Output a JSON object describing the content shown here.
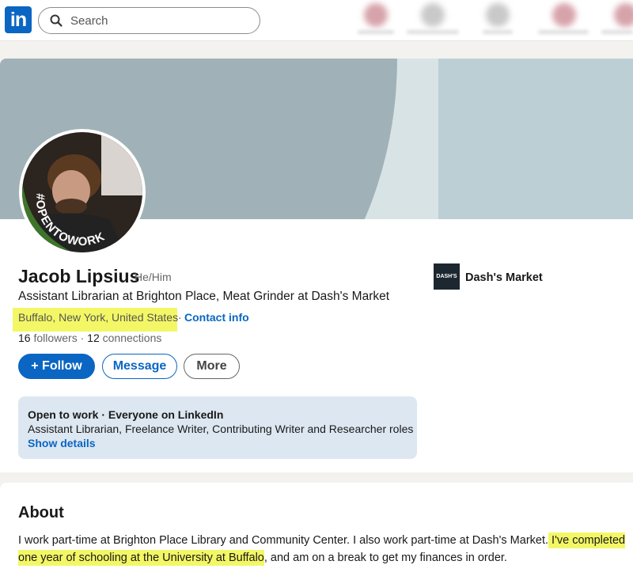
{
  "nav": {
    "logo_text": "in",
    "search_placeholder": "Search"
  },
  "profile": {
    "open_to_work_badge": "#OPENTOWORK",
    "name": "Jacob Lipsius",
    "pronouns": "He/Him",
    "headline": "Assistant Librarian at Brighton Place, Meat Grinder at Dash's Market",
    "location": "Buffalo, New York, United States",
    "separator": "·",
    "contact_info": "Contact info",
    "followers": "16",
    "followers_label": "followers",
    "connections": "12",
    "connections_label": "connections",
    "buttons": {
      "follow": "+ Follow",
      "message": "Message",
      "more": "More"
    },
    "current_company": {
      "logo_text": "DASH'S",
      "name": "Dash's Market"
    },
    "open_to_work": {
      "title": "Open to work · Everyone on LinkedIn",
      "roles": "Assistant Librarian, Freelance Writer, Contributing Writer and Researcher roles",
      "link": "Show details"
    }
  },
  "about": {
    "title": "About",
    "text_part1": "I work part-time at Brighton Place Library and Community Center. I also work part-time at Dash's Market.",
    "text_highlight": " I've completed one year of schooling at the University at Buffalo",
    "text_part2": ", and am on a break to get my finances in order."
  },
  "colors": {
    "accent": "#0a66c2",
    "highlight": "#f3f765",
    "open_to_work_ring": "#3f7a2b"
  }
}
